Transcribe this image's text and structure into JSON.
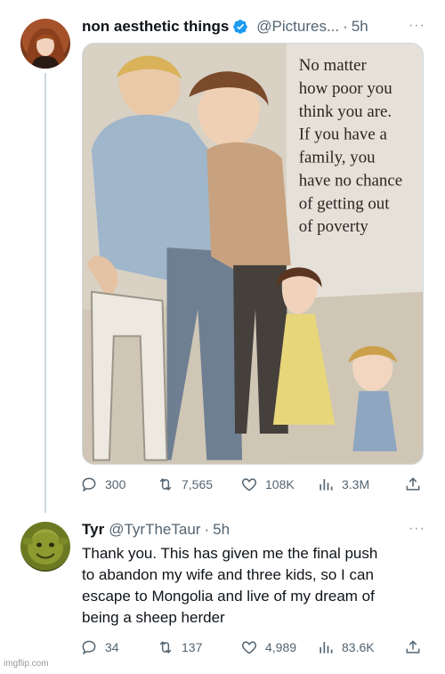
{
  "tweet1": {
    "display_name": "non aesthetic things",
    "handle": "@Pictures...",
    "dot": "·",
    "time": "5h",
    "more": "···",
    "image_caption_lines": [
      "No matter",
      "how poor you",
      "think you are.",
      "If you have a",
      "family, you",
      "have no chance",
      "of getting out",
      "of poverty"
    ],
    "stats": {
      "replies": "300",
      "retweets": "7,565",
      "likes": "108K",
      "views": "3.3M"
    }
  },
  "tweet2": {
    "display_name": "Tyr",
    "handle": "@TyrTheTaur",
    "dot": "·",
    "time": "5h",
    "more": "···",
    "text_lines": [
      "Thank you. This has given me the final push",
      "to abandon my wife and three kids, so I can",
      "escape to Mongolia and live of my dream of",
      "being a sheep herder"
    ],
    "stats": {
      "replies": "34",
      "retweets": "137",
      "likes": "4,989",
      "views": "83.6K"
    }
  },
  "watermark": "imgflip.com",
  "colors": {
    "verified": "#1d9bf0",
    "secondary_text": "#536471",
    "thread_line": "#cfd9de"
  },
  "icons": [
    "reply-icon",
    "retweet-icon",
    "like-icon",
    "views-icon",
    "share-icon",
    "verified-badge-icon",
    "more-icon"
  ]
}
